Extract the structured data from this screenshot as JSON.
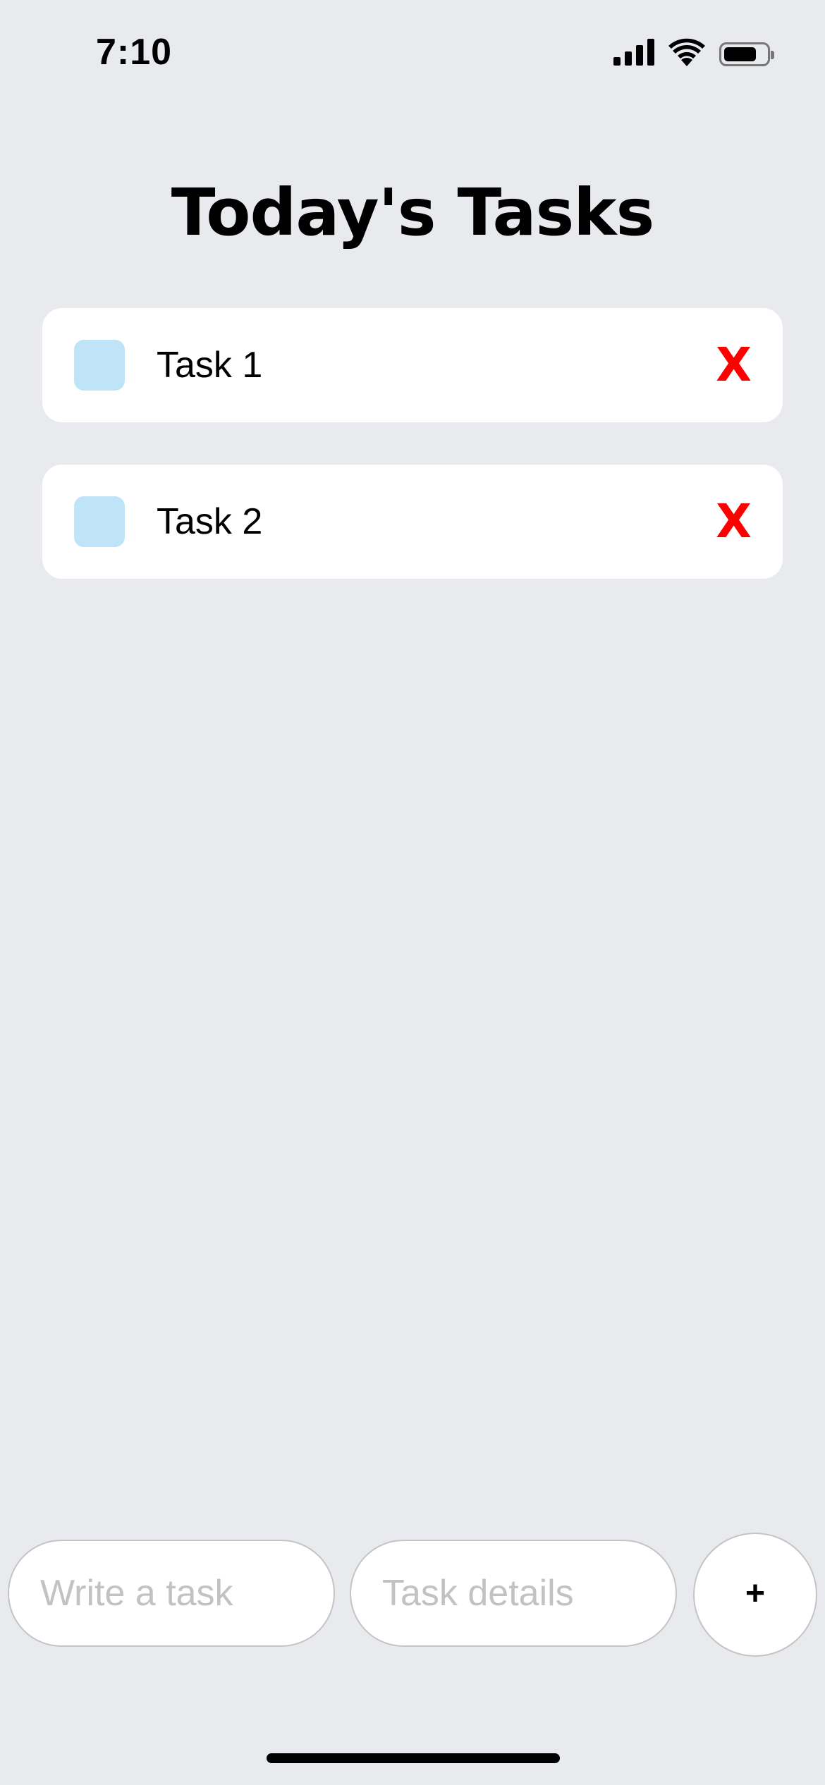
{
  "status_bar": {
    "time": "7:10",
    "icons": [
      "cellular-signal-icon",
      "wifi-icon",
      "battery-icon"
    ]
  },
  "title": "Today's Tasks",
  "tasks": [
    {
      "label": "Task 1",
      "delete_label": "X"
    },
    {
      "label": "Task 2",
      "delete_label": "X"
    }
  ],
  "inputs": {
    "task_placeholder": "Write a task",
    "details_placeholder": "Task details"
  },
  "add_button_label": "+",
  "colors": {
    "background": "#e8eaed",
    "card": "#ffffff",
    "checkbox": "#bfe3f7",
    "delete": "#ff0000",
    "placeholder": "#c2c2c2"
  }
}
